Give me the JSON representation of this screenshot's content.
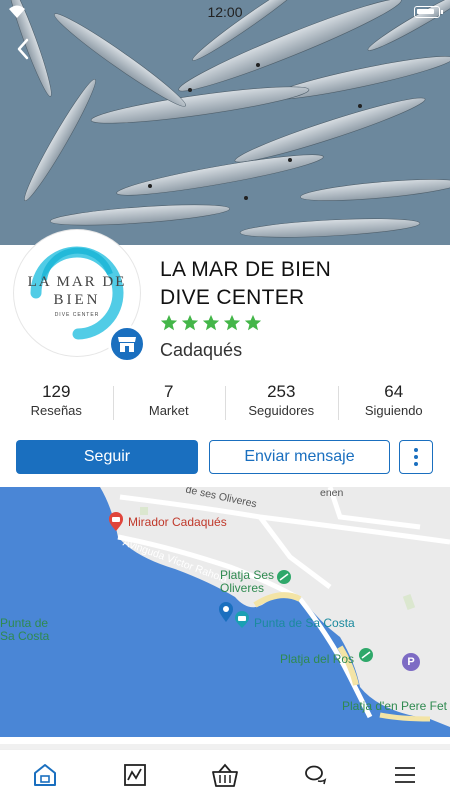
{
  "status": {
    "time": "12:00"
  },
  "profile": {
    "name_line1": "LA MAR DE BIEN",
    "name_line2": "DIVE CENTER",
    "rating": 5,
    "city": "Cadaqués",
    "logo_line1": "LA MAR DE",
    "logo_line2": "BIEN",
    "logo_line3": "DIVE CENTER"
  },
  "stats": [
    {
      "value": "129",
      "label": "Reseñas"
    },
    {
      "value": "7",
      "label": "Market"
    },
    {
      "value": "253",
      "label": "Seguidores"
    },
    {
      "value": "64",
      "label": "Siguiendo"
    }
  ],
  "actions": {
    "follow_label": "Seguir",
    "message_label": "Enviar mensaje"
  },
  "map": {
    "streets": [
      "de ses Oliveres",
      "Avinguda Víctor Rahola",
      "enen"
    ],
    "places": [
      {
        "name": "Mirador Cadaqués"
      },
      {
        "name": "Platja Ses Oliveres"
      },
      {
        "name": "Punta de Sa Costa"
      },
      {
        "name": "Platja del Ros"
      },
      {
        "name": "Platja d'en Pere Fet"
      },
      {
        "name": "Punta de Sa Costa"
      }
    ]
  },
  "nav": [
    "home-icon",
    "activity-icon",
    "market-basket-icon",
    "chat-icon",
    "menu-icon"
  ],
  "colors": {
    "accent": "#1a6fbf",
    "star": "#44b649",
    "sea": "#4a86d6"
  }
}
